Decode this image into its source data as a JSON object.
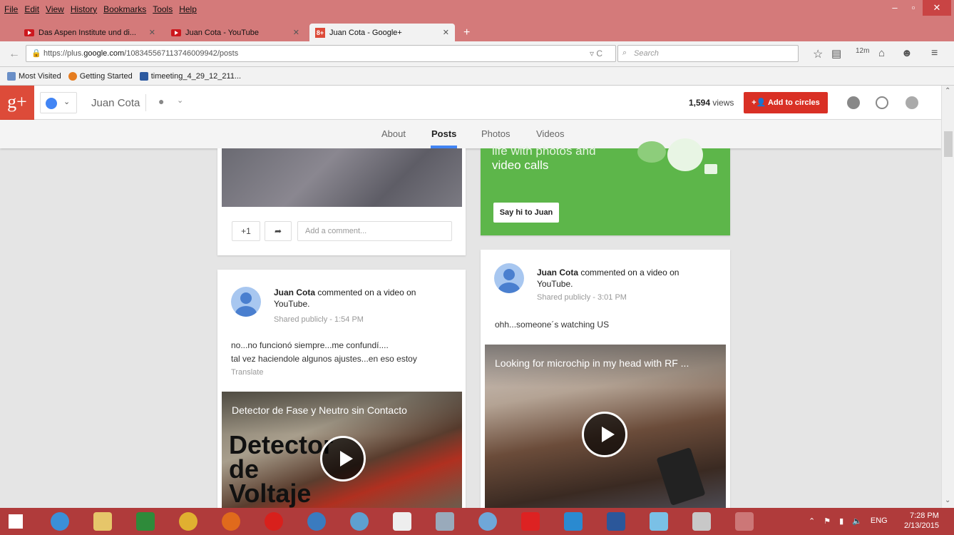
{
  "browser": {
    "menu": [
      "File",
      "Edit",
      "View",
      "History",
      "Bookmarks",
      "Tools",
      "Help"
    ],
    "tabs": [
      {
        "title": "Das Aspen Institute und di...",
        "icon": "youtube-icon",
        "active": false
      },
      {
        "title": "Juan Cota - YouTube",
        "icon": "youtube-icon",
        "active": false
      },
      {
        "title": "Juan Cota - Google+",
        "icon": "google-plus-icon",
        "active": true
      }
    ],
    "url_prefix": "https://plus.",
    "url_domain": "google.com",
    "url_rest": "/108345567113746009942/posts",
    "search_placeholder": "Search",
    "bookmarks": [
      "Most Visited",
      "Getting Started",
      "timeeting_4_29_12_211..."
    ]
  },
  "gplus": {
    "profile_name": "Juan Cota",
    "views": "1,594",
    "views_label": "views",
    "add_to_circles": "Add to circles",
    "nav_tabs": [
      "About",
      "Posts",
      "Photos",
      "Videos"
    ],
    "active_tab": "Posts"
  },
  "cards": {
    "hangout": {
      "text_line1": "life with photos and",
      "text_line2": "video calls",
      "button": "Say hi to Juan"
    },
    "actions": {
      "plus_one": "+1",
      "comment_placeholder": "Add a comment..."
    },
    "post_left": {
      "author": "Juan Cota",
      "action": "commented on a video on",
      "action2": "YouTube.",
      "visibility": "Shared publicly",
      "time": "1:54 PM",
      "line1": "no...no funcionó siempre...me confundí....",
      "line2": "tal vez haciendole algunos ajustes...en eso estoy",
      "translate": "Translate",
      "video_title": "Detector de Fase y Neutro sin Contacto",
      "video_big_text1": "Detector",
      "video_big_text2": "de",
      "video_big_text3": "Voltaje"
    },
    "post_right": {
      "author": "Juan Cota",
      "action": "commented on a video on",
      "action2": "YouTube.",
      "visibility": "Shared publicly",
      "time": "3:01 PM",
      "line1": "ohh...someone´s  watching US",
      "video_title": "Looking for microchip in my head with RF ..."
    }
  },
  "taskbar": {
    "tray_lang": "ENG",
    "time": "7:28 PM",
    "date": "2/13/2015"
  },
  "colors": {
    "titlebar": "#d47a7a",
    "gplus_red": "#dd4b39",
    "hangout_green": "#5db64a",
    "taskbar": "#b03b3b"
  }
}
